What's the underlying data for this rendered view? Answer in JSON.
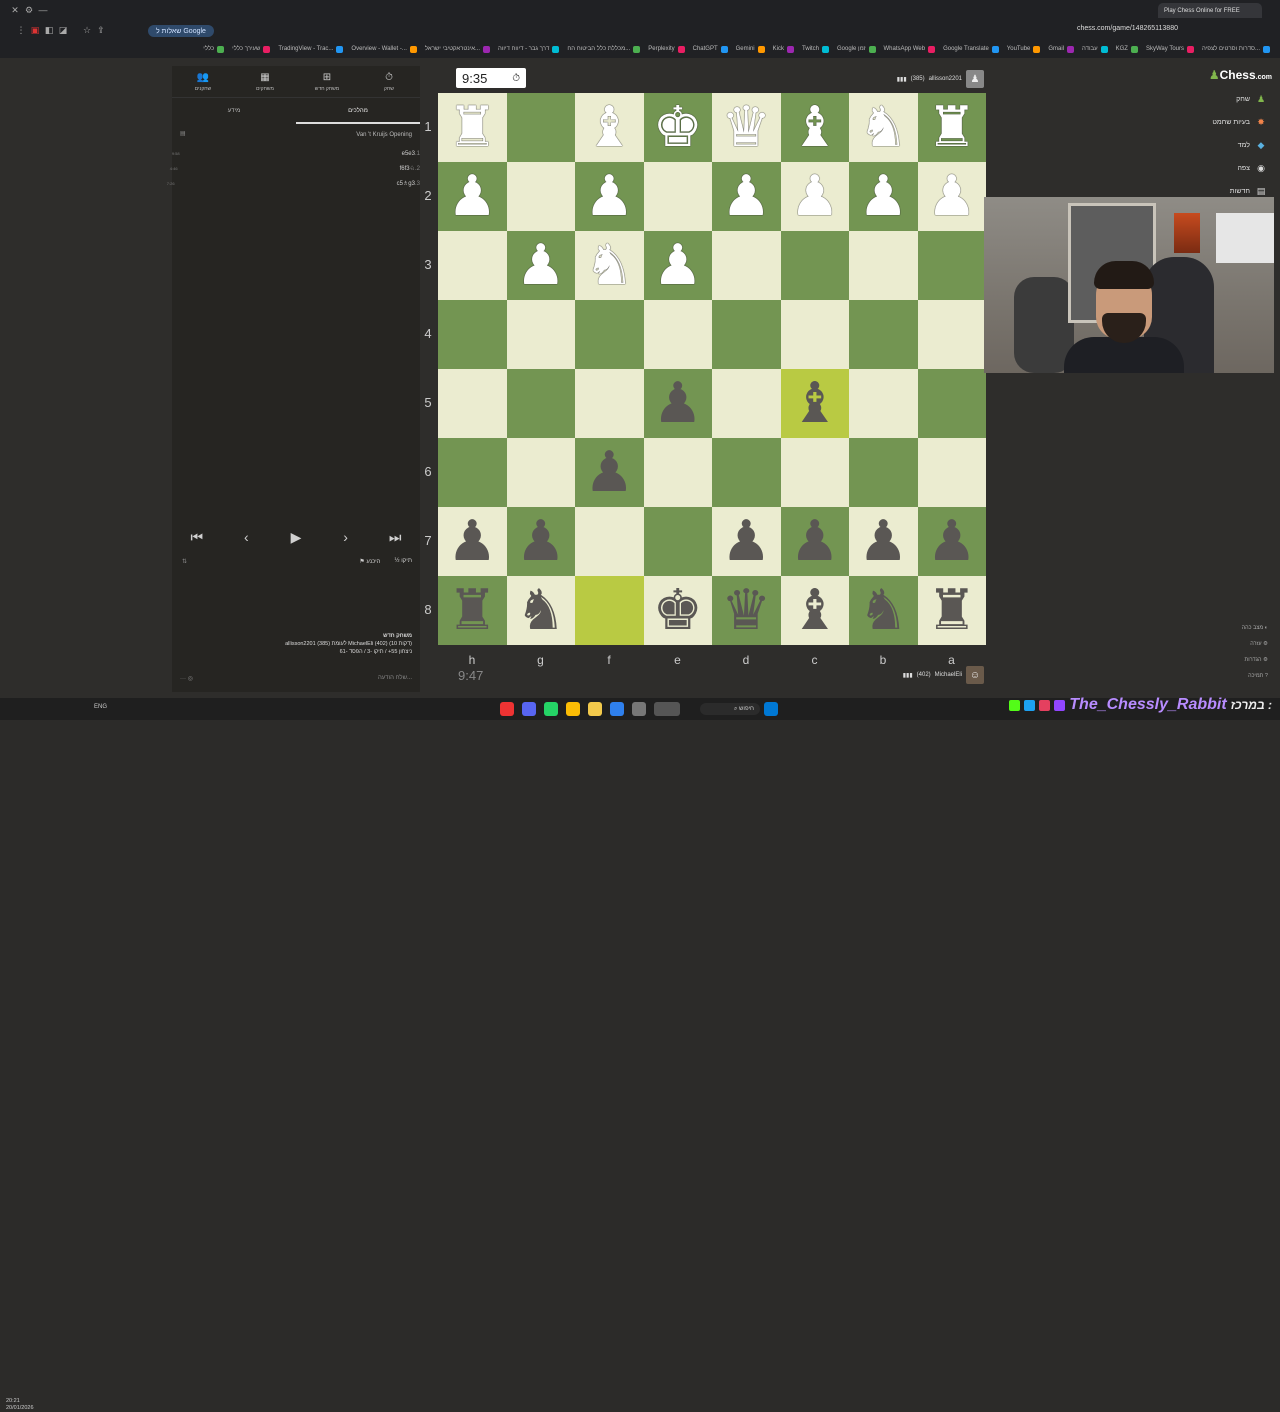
{
  "browser": {
    "tab_title": "Play Chess Online for FREE",
    "url": "chess.com/game/148265113880",
    "tab_pill": "שאלות ל Google",
    "bookmarks": [
      "כללי",
      "שעירך כללי",
      "TradingView - Trac...",
      "Overview - Wallet -...",
      "אינטראקטיבי ישראל...",
      "דרך גבר - דיווח דיווה",
      "מכללת כלל הביטוח הח...",
      "Perplexity",
      "ChatGPT",
      "Gemini",
      "Kick",
      "Twitch",
      "Google זמן",
      "WhatsApp Web",
      "Google Translate",
      "YouTube",
      "Gmail",
      "עבודה",
      "KGZ",
      "SkyWay Tours",
      "סדרות וסרטים לצפיה..."
    ]
  },
  "left_panel": {
    "tabs": [
      "שחק",
      "משחק חדש",
      "משחקים",
      "שחקנים"
    ],
    "subtabs": {
      "moves": "מהלכים",
      "info": "מידע"
    },
    "opening": "Van 't Kruijs Opening",
    "moves": [
      {
        "num": "1.",
        "white": "e3",
        "black": "e5",
        "time": "9:58"
      },
      {
        "num": "2.",
        "white": "♘f3",
        "black": "f6",
        "time": "4:46"
      },
      {
        "num": "3.",
        "white": "g3",
        "black": "♗c5",
        "time": "7:26"
      }
    ],
    "controls": {
      "draw": "תיקו",
      "resign": "היכנע",
      "half": "½"
    },
    "game_info": {
      "title": "משחק חדש",
      "players": "allisson2201 (385) לעומת MichaelEli (402) (10 דקות)",
      "result": "ניצחון 55+ / תיקו -3 / הפסד -61"
    },
    "chat_placeholder": "שלח הודעה..."
  },
  "game": {
    "top_clock": "9:35",
    "bottom_clock": "9:47",
    "top_player": {
      "name": "allisson2201",
      "rating": "(385)"
    },
    "bottom_player": {
      "name": "MichaelEli",
      "rating": "(402)"
    },
    "ranks": [
      "1",
      "2",
      "3",
      "4",
      "5",
      "6",
      "7",
      "8"
    ],
    "files": [
      "h",
      "g",
      "f",
      "e",
      "d",
      "c",
      "b",
      "a"
    ],
    "board": [
      [
        "wR",
        "",
        "wB",
        "wK",
        "wQ",
        "wB",
        "wN",
        "wR"
      ],
      [
        "wP",
        "",
        "wP",
        "",
        "wP",
        "wP",
        "wP",
        "wP"
      ],
      [
        "",
        "wP",
        "wN",
        "wP",
        "",
        "",
        "",
        ""
      ],
      [
        "",
        "",
        "",
        "",
        "",
        "",
        "",
        ""
      ],
      [
        "",
        "",
        "",
        "bP",
        "",
        "bB",
        "",
        ""
      ],
      [
        "",
        "",
        "bP",
        "",
        "",
        "",
        "",
        ""
      ],
      [
        "bP",
        "bP",
        "",
        "",
        "bP",
        "bP",
        "bP",
        "bP"
      ],
      [
        "bR",
        "bN",
        "",
        "bK",
        "bQ",
        "bB",
        "bN",
        "bR"
      ]
    ],
    "highlights": [
      "4-5",
      "7-2"
    ]
  },
  "right_nav": {
    "logo_main": "Chess",
    "logo_suffix": ".com",
    "items": [
      "שחק",
      "בעיות שחמט",
      "למד",
      "צפה",
      "חדשות"
    ],
    "bottom_items": [
      "מצב כהה",
      "עזרה",
      "הגדרות",
      "תמיכה"
    ]
  },
  "taskbar": {
    "time": "20:21",
    "date": "20/01/2026",
    "lang": "ENG",
    "search": "חיפוש"
  },
  "channel": {
    "name": "The_Chessly_Rabbit",
    "prefix": "במרכז :"
  }
}
